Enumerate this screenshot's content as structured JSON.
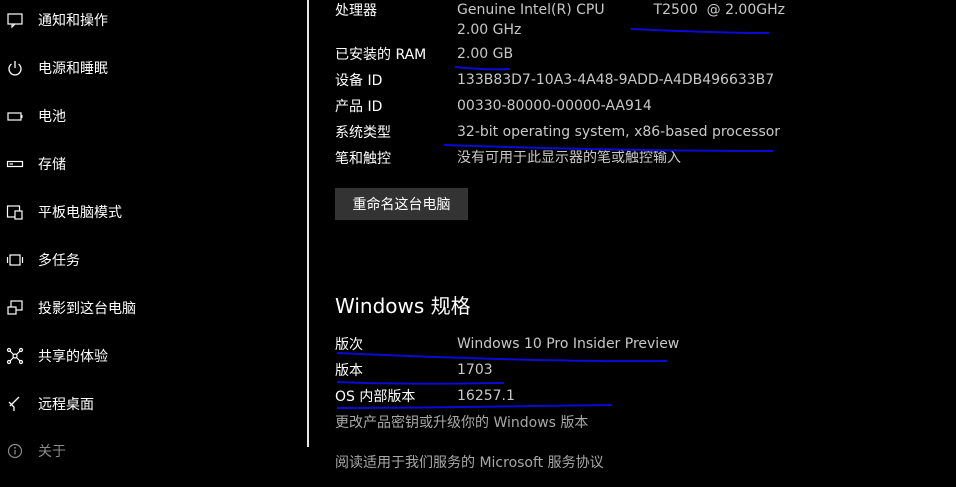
{
  "sidebar": {
    "items": [
      {
        "label": "通知和操作",
        "icon": "notification-icon"
      },
      {
        "label": "电源和睡眠",
        "icon": "power-icon"
      },
      {
        "label": "电池",
        "icon": "battery-icon"
      },
      {
        "label": "存储",
        "icon": "storage-icon"
      },
      {
        "label": "平板电脑模式",
        "icon": "tablet-mode-icon"
      },
      {
        "label": "多任务",
        "icon": "multitasking-icon"
      },
      {
        "label": "投影到这台电脑",
        "icon": "project-icon"
      },
      {
        "label": "共享的体验",
        "icon": "shared-experiences-icon"
      },
      {
        "label": "远程桌面",
        "icon": "remote-desktop-icon"
      },
      {
        "label": "关于",
        "icon": "info-icon"
      }
    ]
  },
  "device_specs": {
    "processor_label": "处理器",
    "processor_value_line1": "Genuine Intel(R) CPU           T2500  @ 2.00GHz",
    "processor_value_line2": "2.00 GHz",
    "ram_label": "已安装的 RAM",
    "ram_value": "2.00 GB",
    "device_id_label": "设备 ID",
    "device_id_value": "133B83D7-10A3-4A48-9ADD-A4DB496633B7",
    "product_id_label": "产品 ID",
    "product_id_value": "00330-80000-00000-AA914",
    "system_type_label": "系统类型",
    "system_type_value": "32-bit operating system, x86-based processor",
    "pen_touch_label": "笔和触控",
    "pen_touch_value": "没有可用于此显示器的笔或触控输入",
    "rename_button": "重命名这台电脑"
  },
  "windows_specs": {
    "title": "Windows 规格",
    "edition_label": "版次",
    "edition_value": "Windows 10 Pro Insider Preview",
    "version_label": "版本",
    "version_value": "1703",
    "os_build_label": "OS 内部版本",
    "os_build_value": "16257.1",
    "change_key_link": "更改产品密钥或升级你的 Windows 版本",
    "service_agreement_link": "阅读适用于我们服务的 Microsoft 服务协议"
  },
  "colors": {
    "background": "#000000",
    "annotation_pen": "#0a0ad6",
    "value_text": "#c8c8c8",
    "link_text": "#a8a8a8"
  }
}
